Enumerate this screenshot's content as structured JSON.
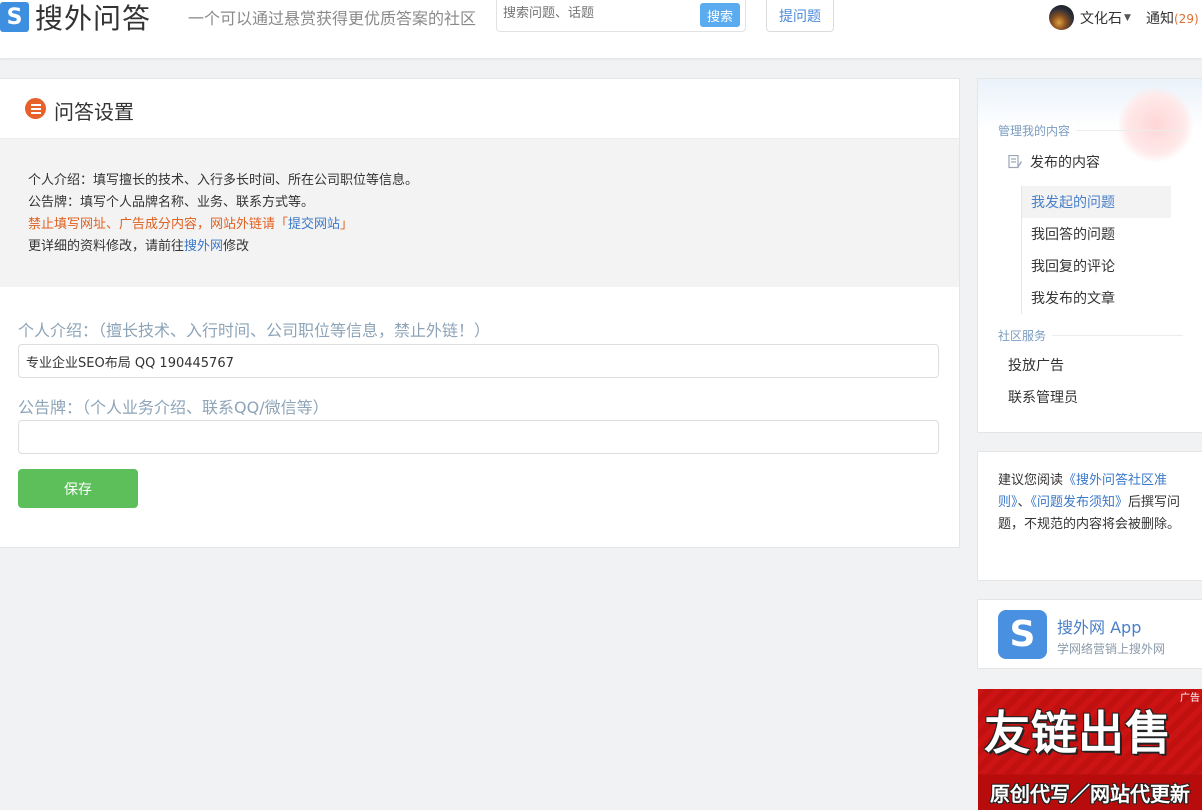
{
  "header": {
    "logo_badge": "S",
    "logo_text": "搜外问答",
    "slogan": "一个可以通过悬赏获得更优质答案的社区",
    "search_placeholder": "搜索问题、话题",
    "search_button": "搜索",
    "ask_button": "提问题",
    "user_name": "文化石",
    "notify_label": "通知",
    "notify_count": "(29)"
  },
  "main": {
    "title": "问答设置",
    "tips": {
      "line1": "个人介绍：填写擅长的技术、入行多长时间、所在公司职位等信息。",
      "line2": "公告牌：填写个人品牌名称、业务、联系方式等。",
      "line3_prefix": "禁止填写网址、广告成分内容，网站外链请「",
      "line3_link": "提交网站",
      "line3_suffix": "」",
      "line4_prefix": "更详细的资料修改，请前往",
      "line4_link": "搜外网",
      "line4_suffix": "修改"
    },
    "intro_label": "个人介绍：（擅长技术、入行时间、公司职位等信息，禁止外链！）",
    "intro_value": "专业企业SEO布局 QQ 190445767",
    "board_label": "公告牌：（个人业务介绍、联系QQ/微信等）",
    "board_value": "",
    "save_button": "保存"
  },
  "sidebar": {
    "manage_label": "管理我的内容",
    "published_label": "发布的内容",
    "sub_items": [
      "我发起的问题",
      "我回答的问题",
      "我回复的评论",
      "我发布的文章"
    ],
    "community_label": "社区服务",
    "community_items": [
      "投放广告",
      "联系管理员"
    ],
    "notice": {
      "prefix": "建议您阅读",
      "link1": "《搜外问答社区准则》",
      "sep": "、",
      "link2": "《问题发布须知》",
      "suffix": "后撰写问题，不规范的内容将会被删除。"
    },
    "app": {
      "icon_letter": "S",
      "name": "搜外网 App",
      "desc": "学网络营销上搜外网"
    },
    "ad": {
      "tag": "广告",
      "title": "友链出售",
      "subtitle": "原创代写／网站代更新"
    }
  },
  "colors": {
    "accent_blue": "#3a78c8",
    "save_green": "#5cbf5a",
    "warn_orange": "#e06020",
    "title_icon": "#e8602a"
  }
}
